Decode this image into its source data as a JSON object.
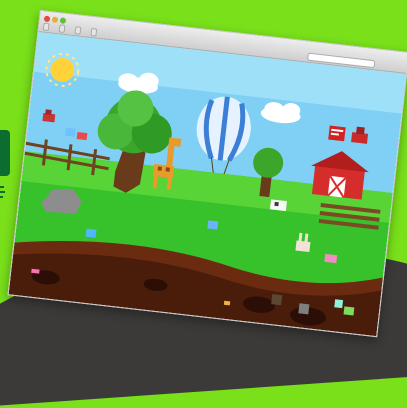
{
  "browser": {
    "title": "",
    "url": "",
    "toolbar_labels": [
      "",
      "",
      "",
      ""
    ]
  },
  "icons": [
    "sun-icon",
    "hot-air-balloon-icon",
    "tree-icon",
    "giraffe-icon",
    "barn-icon",
    "rock-icon",
    "bunny-icon",
    "bird-icon",
    "cow-icon",
    "fence-icon"
  ],
  "colors": {
    "page_bg": "#79e01a",
    "sky": "#7fd0f4",
    "grass": "#37c12a",
    "underground": "#6a2b10",
    "barn": "#d52c2c"
  }
}
